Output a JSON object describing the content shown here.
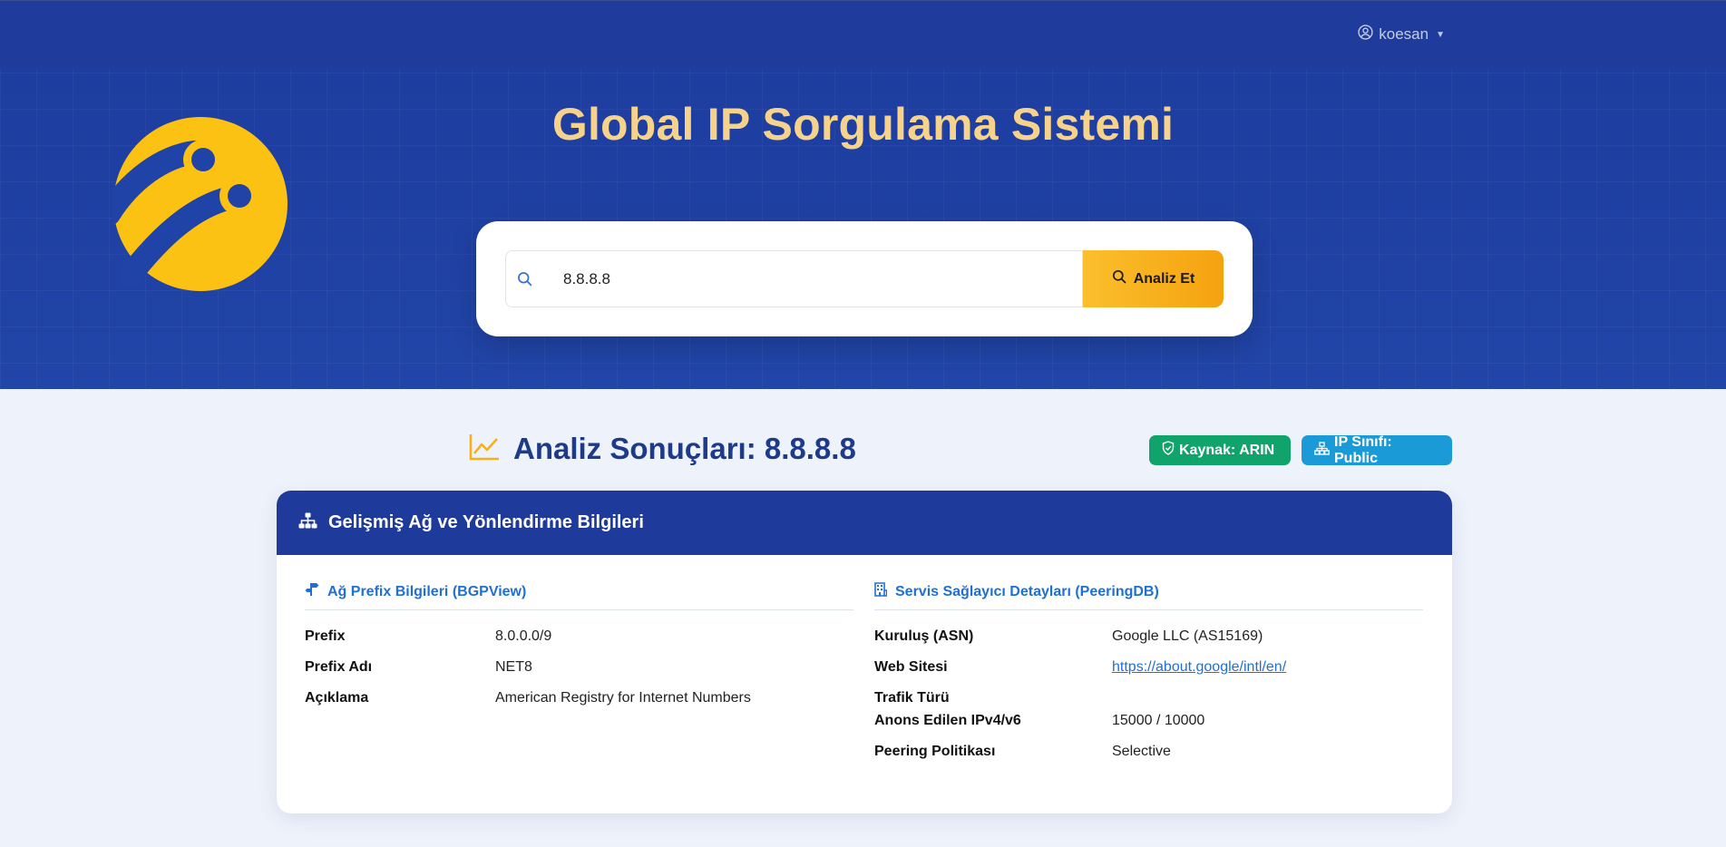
{
  "user": {
    "name": "koesan"
  },
  "hero": {
    "title": "Global IP Sorgulama Sistemi"
  },
  "search": {
    "value": "8.8.8.8",
    "button_label": "Analiz Et"
  },
  "results": {
    "title": "Analiz Sonuçları: 8.8.8.8",
    "badge_source": "Kaynak: ARIN",
    "badge_class": "IP Sınıfı: Public",
    "card_title": "Gelişmiş Ağ ve Yönlendirme Bilgileri",
    "prefix_section": {
      "title": "Ağ Prefix Bilgileri (BGPView)",
      "rows": [
        {
          "label": "Prefix",
          "value": "8.0.0.0/9"
        },
        {
          "label": "Prefix Adı",
          "value": "NET8"
        },
        {
          "label": "Açıklama",
          "value": "American Registry for Internet Numbers"
        }
      ]
    },
    "provider_section": {
      "title": "Servis Sağlayıcı Detayları (PeeringDB)",
      "org_label": "Kuruluş (ASN)",
      "org_value": "Google LLC (AS15169)",
      "website_label": "Web Sitesi",
      "website_value": "https://about.google/intl/en/",
      "traffic_label": "Trafik Türü",
      "traffic_value": "",
      "announced_label": "Anons Edilen IPv4/v6",
      "announced_value": "15000 / 10000",
      "policy_label": "Peering Politikası",
      "policy_value": "Selective"
    }
  },
  "colors": {
    "hero_bg": "#1e3a9e",
    "accent_yellow": "#fbbf2d",
    "title_gold": "#f6d28a",
    "link_blue": "#1f6fd6",
    "badge_green": "#10a46c",
    "badge_blue": "#1a9bd7"
  }
}
